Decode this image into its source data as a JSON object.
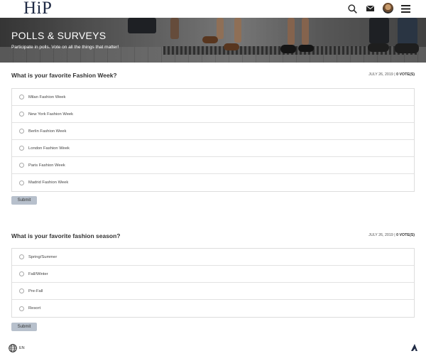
{
  "header": {
    "logo": "HiP",
    "icons": [
      "search-icon",
      "mail-icon",
      "avatar",
      "hamburger-menu-icon"
    ]
  },
  "hero": {
    "title": "POLLS & SURVEYS",
    "subtitle": "Participate in polls. Vote on all the things that matter!"
  },
  "polls": [
    {
      "question": "What is your favorite Fashion Week?",
      "date": "JULY 26, 2019",
      "separator": "|",
      "votes": "0 VOTE(S)",
      "options": [
        "Milan Fashion Week",
        "New York Fashion Week",
        "Berlin Fashion Week",
        "London Fashion Week",
        "Paris Fashion Week",
        "Madrid Fashion Week"
      ],
      "submit_label": "Submit"
    },
    {
      "question": "What is your favorite fashion season?",
      "date": "JULY 26, 2019",
      "separator": "|",
      "votes": "0 VOTE(S)",
      "options": [
        "Spring/Summer",
        "Fall/Winter",
        "Pre-Fall",
        "Resort"
      ],
      "submit_label": "Submit"
    }
  ],
  "footer": {
    "language": "EN"
  },
  "colors": {
    "logo": "#1f2a44",
    "submit_bg": "#b7c0cc",
    "border": "#dddddd"
  }
}
